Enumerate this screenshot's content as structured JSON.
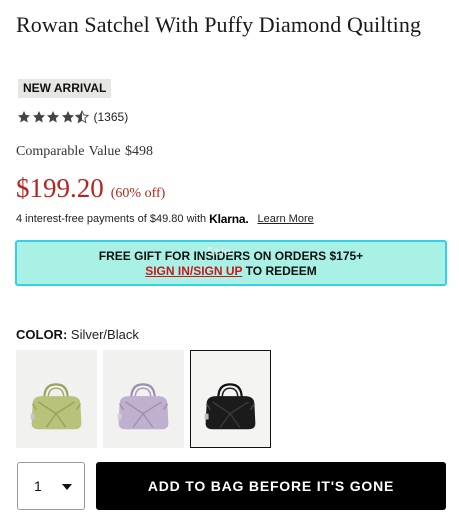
{
  "product": {
    "title": "Rowan Satchel With Puffy Diamond Quilting",
    "badge": "NEW ARRIVAL",
    "rating": 4.5,
    "review_count": "(1365)",
    "comparable_label": "Comparable Value",
    "comparable_value": "$498",
    "price": "$199.20",
    "discount": "(60% off)"
  },
  "klarna": {
    "text": "4 interest-free payments of $49.80 with",
    "logo": "Klarna.",
    "learn_more": "Learn More"
  },
  "promo": {
    "line1": "FREE GIFT FOR INSIDERS ON ORDERS $175+",
    "link": "SIGN IN/SIGN UP",
    "line2_suffix": " TO REDEEM",
    "watermark": "5ele",
    "bg_color": "#a9f1e4",
    "border_color": "#35d0e7"
  },
  "color": {
    "label": "COLOR:",
    "selected": "Silver/Black",
    "swatches": [
      {
        "name": "lime",
        "fill": "#b9c27a",
        "selected": false
      },
      {
        "name": "lilac",
        "fill": "#bfb0cf",
        "selected": false
      },
      {
        "name": "black",
        "fill": "#1b1b1b",
        "selected": true
      }
    ]
  },
  "cart": {
    "quantity": "1",
    "button_label": "ADD TO BAG BEFORE IT'S GONE"
  },
  "colors": {
    "price_red": "#b4261f",
    "link_red": "#c8181d"
  }
}
